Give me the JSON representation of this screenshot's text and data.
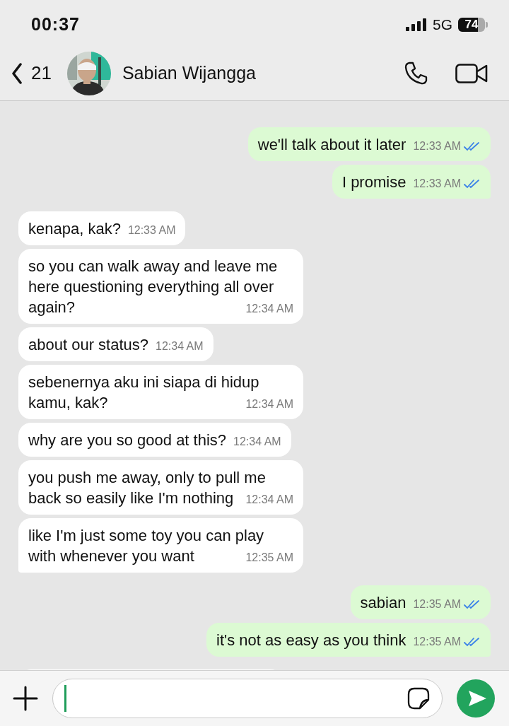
{
  "status_bar": {
    "time": "00:37",
    "network": "5G",
    "battery": "74"
  },
  "header": {
    "back_count": "21",
    "contact_name": "Sabian Wijangga"
  },
  "messages": [
    {
      "kind": "outgoing",
      "text": "we'll talk about it later",
      "time": "12:33 AM",
      "read": true
    },
    {
      "kind": "outgoing",
      "text": "I promise",
      "time": "12:33 AM",
      "read": true
    },
    {
      "kind": "incoming",
      "text": "kenapa, kak?",
      "time": "12:33 AM"
    },
    {
      "kind": "incoming",
      "text": "so you can walk away and leave me here questioning everything all over again?",
      "time": "12:34 AM"
    },
    {
      "kind": "incoming",
      "text": "about our status?",
      "time": "12:34 AM"
    },
    {
      "kind": "incoming",
      "text": "sebenernya aku ini siapa di hidup kamu, kak?",
      "time": "12:34 AM"
    },
    {
      "kind": "incoming",
      "text": "why are you so good at this?",
      "time": "12:34 AM"
    },
    {
      "kind": "incoming",
      "text": "you push me away, only to pull me back so easily like I'm nothing",
      "time": "12:34 AM"
    },
    {
      "kind": "incoming",
      "text": "like I'm just some toy you can play with whenever you want",
      "time": "12:35 AM"
    },
    {
      "kind": "outgoing",
      "text": "sabian",
      "time": "12:35 AM",
      "read": true
    },
    {
      "kind": "outgoing",
      "text": "it's not as easy as you think",
      "time": "12:35 AM",
      "read": true
    },
    {
      "kind": "incoming"
    }
  ]
}
